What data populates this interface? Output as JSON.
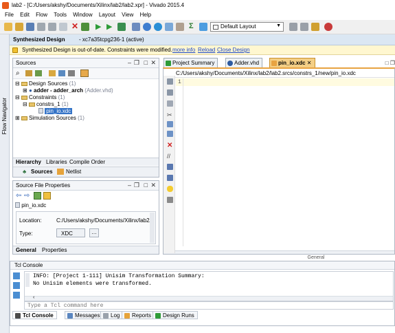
{
  "window": {
    "title": "lab2 - [C:/Users/akshy/Documents/Xilinx/lab2/lab2.xpr] - Vivado 2015.4"
  },
  "menu": [
    "File",
    "Edit",
    "Flow",
    "Tools",
    "Window",
    "Layout",
    "View",
    "Help"
  ],
  "toolbar": {
    "layout_value": "Default Layout"
  },
  "synth_header": {
    "title": "Synthesized Design",
    "part": "- xc7a35tcpg236-1 (active)"
  },
  "warning": {
    "text": "Synthesized Design is out-of-date. Constraints were modified.",
    "more_info": "more info",
    "reload": "Reload",
    "close": "Close Design"
  },
  "flow_navigator": {
    "label": "Flow Navigator"
  },
  "sources": {
    "title": "Sources",
    "tree": {
      "design_sources": "Design Sources",
      "design_sources_count": "(1)",
      "adder_name": "adder - adder_arch",
      "adder_file": "(Adder.vhd)",
      "constraints": "Constraints",
      "constraints_count": "(1)",
      "constrs_1": "constrs_1",
      "constrs_1_count": "(1)",
      "pin_io": "pin_io.xdc",
      "sim_sources": "Simulation Sources",
      "sim_sources_count": "(1)"
    },
    "tabs": [
      "Hierarchy",
      "Libraries",
      "Compile Order"
    ],
    "bottom_tabs": [
      "Sources",
      "Netlist"
    ]
  },
  "props": {
    "title": "Source File Properties",
    "file": "pin_io.xdc",
    "location_label": "Location:",
    "location_value": "C:/Users/akshy/Documents/Xilinx/lab2/lab2",
    "type_label": "Type:",
    "type_value": "XDC",
    "tabs": [
      "General",
      "Properties"
    ]
  },
  "editor": {
    "tabs": [
      "Project Summary",
      "Adder.vhd",
      "pin_io.xdc"
    ],
    "path": "C:/Users/akshy/Documents/Xilinx/lab2/lab2.srcs/constrs_1/new/pin_io.xdc",
    "line1": "1",
    "bottom_label": "General"
  },
  "console": {
    "title": "Tcl Console",
    "line1": "INFO: [Project 1-111] Unisim Transformation Summary:",
    "line2": "No Unisim elements were transformed.",
    "placeholder": "Type a Tcl command here",
    "tabs": [
      "Tcl Console",
      "Messages",
      "Log",
      "Reports",
      "Design Runs"
    ]
  },
  "colors": {
    "accent": "#e8a341",
    "selection": "#3574c7",
    "link": "#1d48c9",
    "warning_bg": "#fff7d0"
  }
}
